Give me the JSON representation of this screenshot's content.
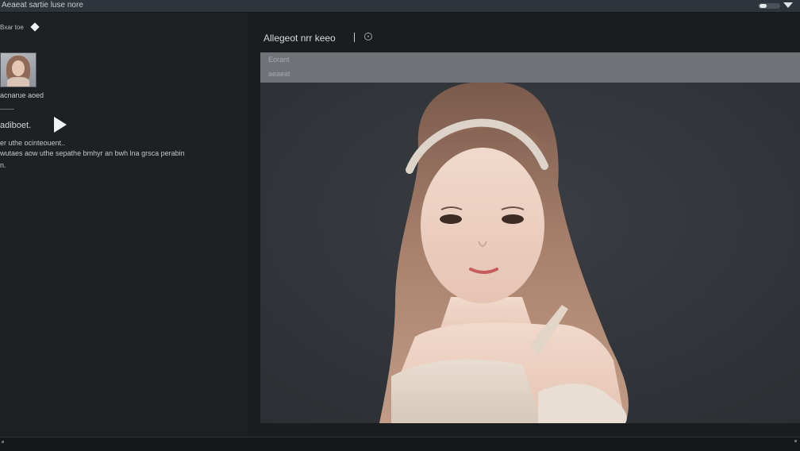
{
  "window": {
    "title": "Aeaeat sartie luse nore"
  },
  "sidebar": {
    "header_label": "Bxar toe",
    "thumbnail_caption": "acnarue aoed",
    "section_title": "adiboet.",
    "description": [
      "er uthe ocinteouent..",
      "wutaes aow uthe sepathe bmhyr an bwh lna grsca perabin",
      "n."
    ]
  },
  "main": {
    "title": "Allegeot nrr keeo",
    "viewer_label_1": "Eorant",
    "viewer_label_2": "aeaeat"
  },
  "colors": {
    "background": "#1b1c20",
    "sidebar": "#1e2024",
    "titlebar": "#2e343b",
    "viewer_header": "#6f7378",
    "viewer_bg": "#33363a"
  },
  "icons": [
    "diamond-icon",
    "play-icon",
    "settings-icon",
    "dropdown-arrow-icon",
    "toggle-icon"
  ]
}
